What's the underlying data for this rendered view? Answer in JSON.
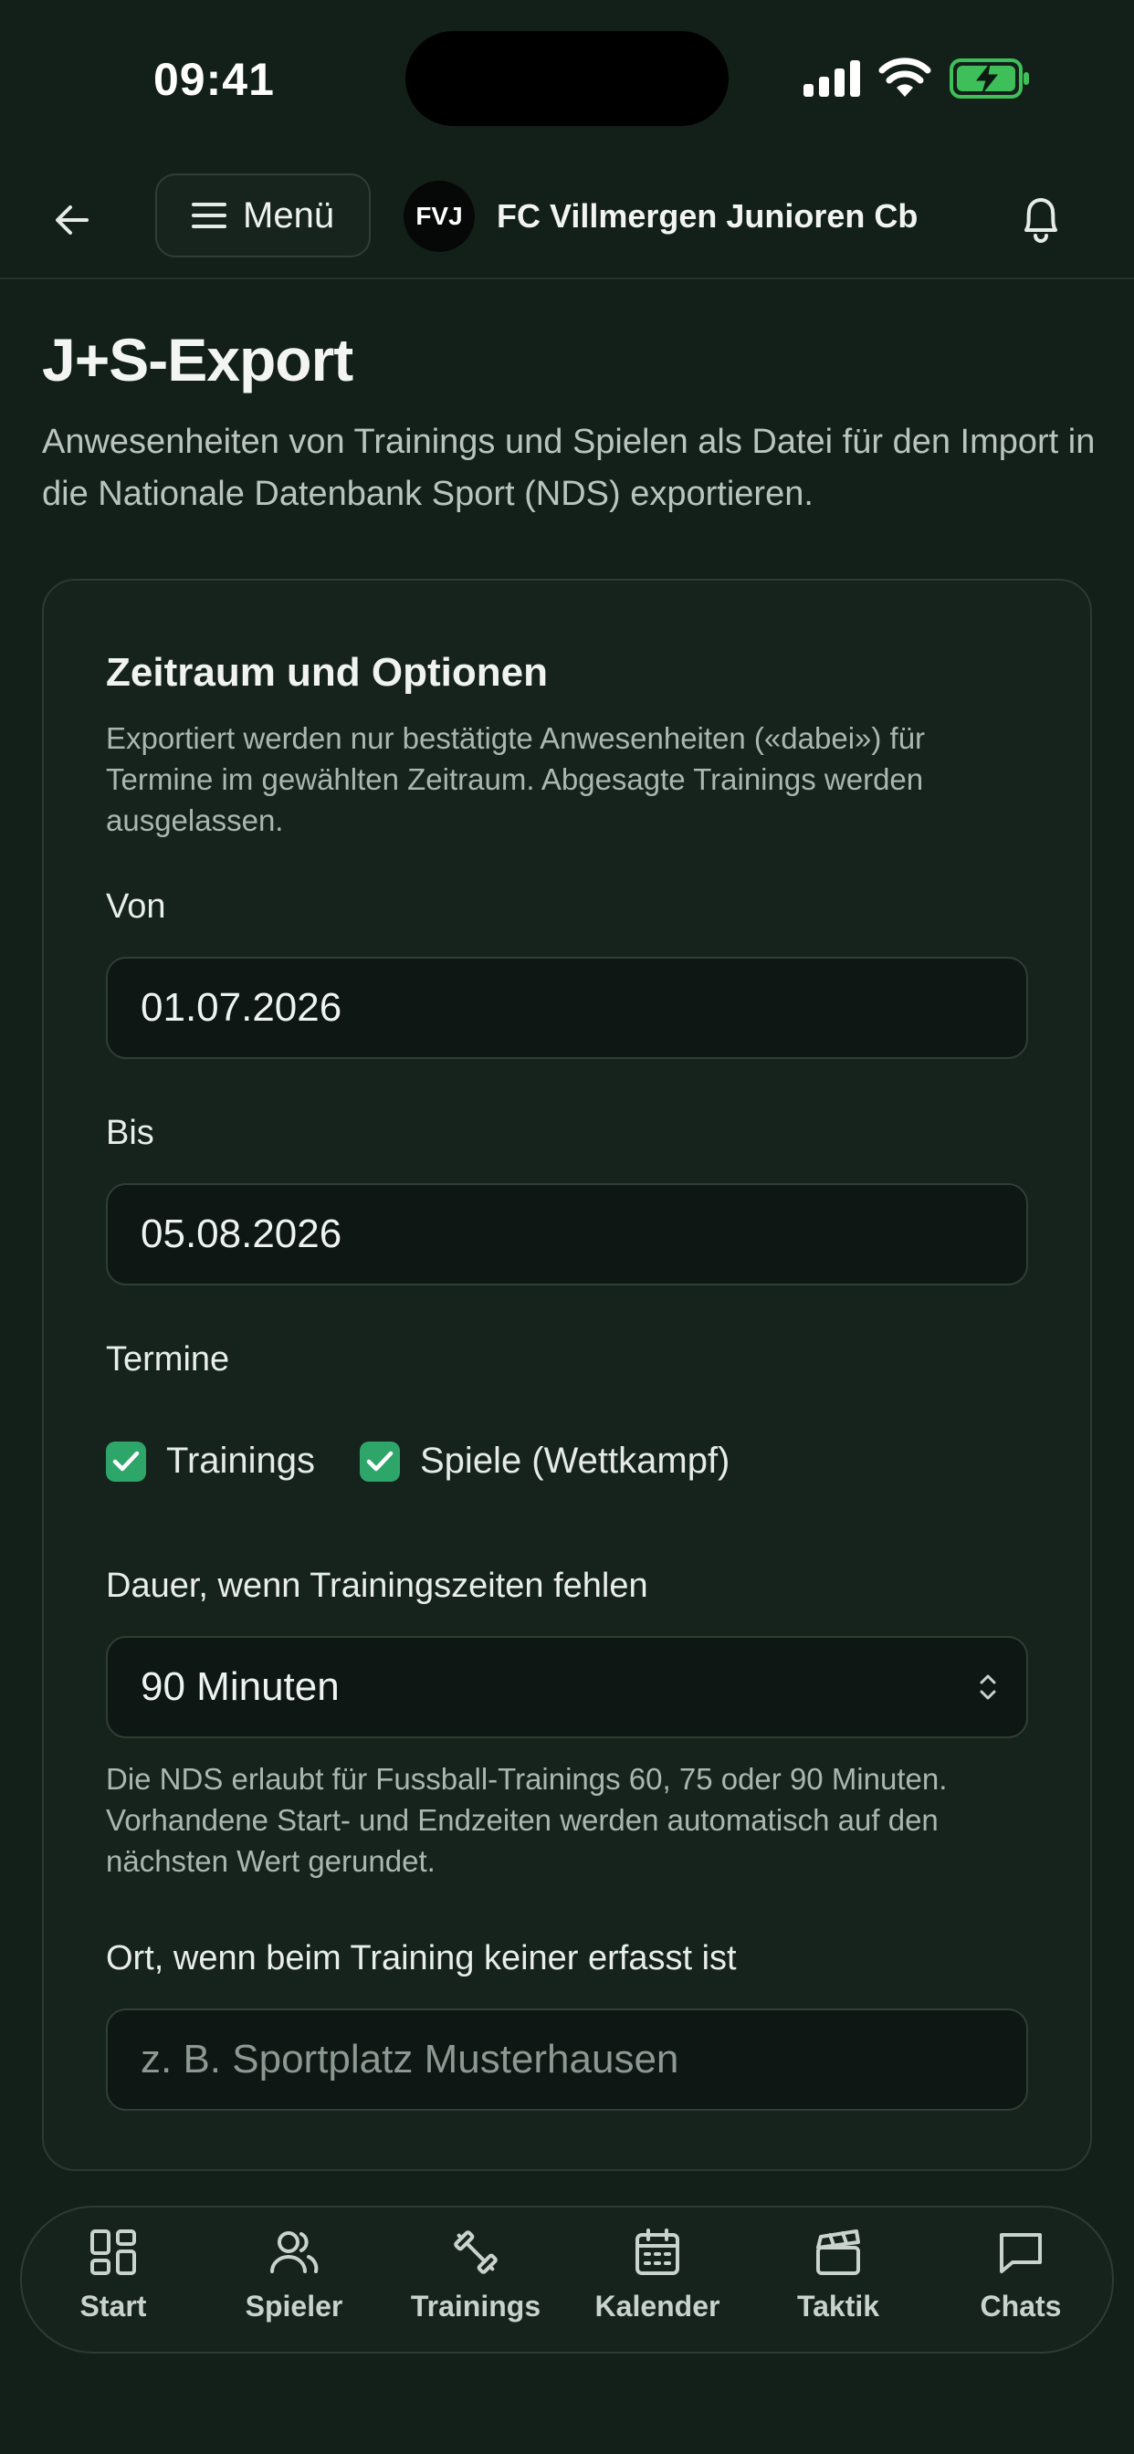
{
  "status_bar": {
    "time": "09:41"
  },
  "header": {
    "menu_label": "Menü",
    "team_logo_text": "FVJ",
    "team_name": "FC Villmergen Junioren Cb"
  },
  "page": {
    "title": "J+S-Export",
    "description": "Anwesenheiten von Trainings und Spielen als Datei für den Import in die Nationale Datenbank Sport (NDS) exportieren."
  },
  "card": {
    "title": "Zeitraum und Optionen",
    "description": "Exportiert werden nur bestätigte Anwesenheiten («dabei») für Termine im gewählten Zeitraum. Abgesagte Trainings werden ausgelassen.",
    "from_label": "Von",
    "from_value": "01.07.2026",
    "to_label": "Bis",
    "to_value": "05.08.2026",
    "events_label": "Termine",
    "trainings_label": "Trainings",
    "games_label": "Spiele (Wettkampf)",
    "duration_label": "Dauer, wenn Trainingszeiten fehlen",
    "duration_value": "90 Minuten",
    "duration_hint": "Die NDS erlaubt für Fussball-Trainings 60, 75 oder 90 Minuten. Vorhandene Start- und Endzeiten werden automatisch auf den nächsten Wert gerundet.",
    "location_label": "Ort, wenn beim Training keiner erfasst ist",
    "location_placeholder": "z. B. Sportplatz Musterhausen"
  },
  "nav": {
    "items": [
      {
        "label": "Start",
        "icon": "grid-icon"
      },
      {
        "label": "Spieler",
        "icon": "users-icon"
      },
      {
        "label": "Trainings",
        "icon": "dumbbell-icon"
      },
      {
        "label": "Kalender",
        "icon": "calendar-icon"
      },
      {
        "label": "Taktik",
        "icon": "clapperboard-icon"
      },
      {
        "label": "Chats",
        "icon": "chat-icon"
      }
    ]
  },
  "colors": {
    "background": "#132019",
    "accent": "#2ea66a",
    "battery": "#3fbf5a"
  }
}
